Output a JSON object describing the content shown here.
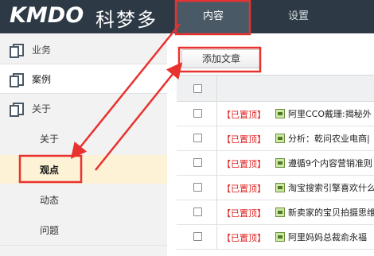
{
  "header": {
    "brand": "KMDO",
    "brand_cn": "科梦多",
    "tabs": [
      {
        "label": "内容",
        "active": true
      },
      {
        "label": "设置",
        "active": false
      },
      {
        "label": "",
        "active": false
      }
    ]
  },
  "sidebar": {
    "sections": [
      {
        "label": "业务",
        "icon": "document-icon"
      },
      {
        "label": "案例",
        "icon": "document-icon",
        "selected": true
      },
      {
        "label": "关于",
        "icon": "document-icon"
      }
    ],
    "sub_items": [
      {
        "label": "关于"
      },
      {
        "label": "观点",
        "current": true
      },
      {
        "label": "动态"
      },
      {
        "label": "问题"
      }
    ]
  },
  "content": {
    "add_button": "添加文章",
    "rows": [
      {
        "tag": "【已置顶】",
        "title": "阿里CCO戴珊:揭秘外"
      },
      {
        "tag": "【已置顶】",
        "title": "分析：乾问农业电商|"
      },
      {
        "tag": "【已置顶】",
        "title": "遵循9个内容营销准则"
      },
      {
        "tag": "【已置顶】",
        "title": "淘宝搜索引擎喜欢什么"
      },
      {
        "tag": "【已置顶】",
        "title": "新卖家的宝贝拍摄思维"
      },
      {
        "tag": "【已置顶】",
        "title": "阿里妈妈总裁俞永福"
      }
    ]
  },
  "colors": {
    "topbar": "#2d3a46",
    "active_tab": "#4a5966",
    "annotation_red": "#e8322f",
    "pin_tag_red": "#e02020",
    "current_item_bg": "#fdf2d6"
  }
}
